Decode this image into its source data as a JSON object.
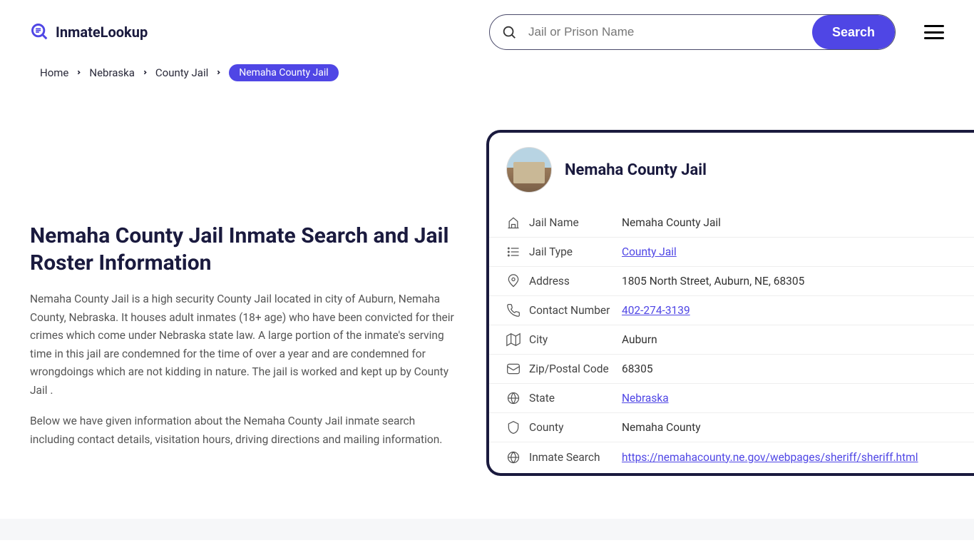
{
  "brand": {
    "name": "InmateLookup"
  },
  "search": {
    "placeholder": "Jail or Prison Name",
    "button_label": "Search"
  },
  "breadcrumb": {
    "items": [
      "Home",
      "Nebraska",
      "County Jail"
    ],
    "current": "Nemaha County Jail"
  },
  "main": {
    "title": "Nemaha County Jail Inmate Search and Jail Roster Information",
    "paragraph1": "Nemaha County Jail is a high security County Jail located in city of Auburn, Nemaha County, Nebraska. It houses adult inmates (18+ age) who have been convicted for their crimes which come under Nebraska state law. A large portion of the inmate's serving time in this jail are condemned for the time of over a year and are condemned for wrongdoings which are not kidding in nature. The jail is worked and kept up by County Jail .",
    "paragraph2": "Below we have given information about the Nemaha County Jail inmate search including contact details, visitation hours, driving directions and mailing information."
  },
  "card": {
    "title": "Nemaha County Jail",
    "rows": [
      {
        "label": "Jail Name",
        "value": "Nemaha County Jail",
        "link": false
      },
      {
        "label": "Jail Type",
        "value": "County Jail",
        "link": true
      },
      {
        "label": "Address",
        "value": "1805 North Street, Auburn, NE, 68305",
        "link": false
      },
      {
        "label": "Contact Number",
        "value": "402-274-3139",
        "link": true
      },
      {
        "label": "City",
        "value": "Auburn",
        "link": false
      },
      {
        "label": "Zip/Postal Code",
        "value": "68305",
        "link": false
      },
      {
        "label": "State",
        "value": "Nebraska",
        "link": true
      },
      {
        "label": "County",
        "value": "Nemaha County",
        "link": false
      },
      {
        "label": "Inmate Search",
        "value": "https://nemahacounty.ne.gov/webpages/sheriff/sheriff.html",
        "link": true
      }
    ]
  }
}
